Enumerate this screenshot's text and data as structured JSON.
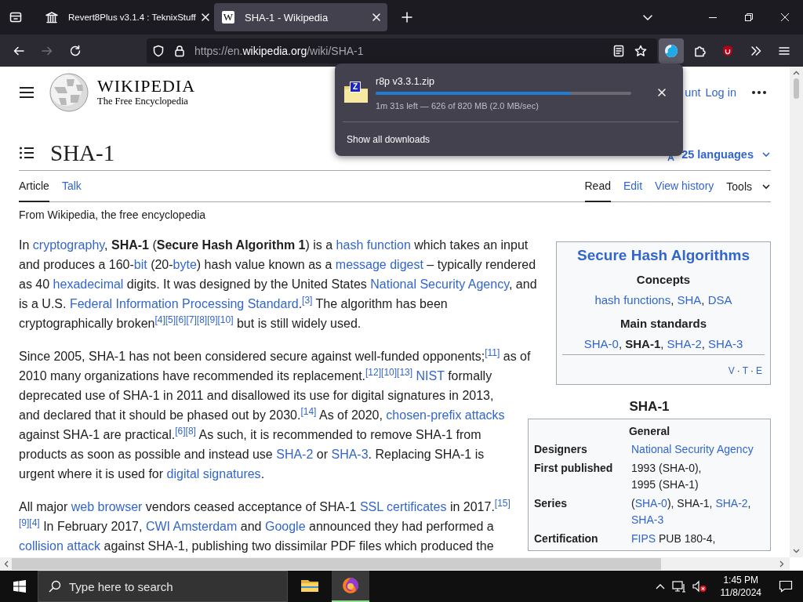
{
  "browser": {
    "tabs": [
      {
        "title": "Revert8Plus v3.1.4 : TeknixStuff",
        "icon": {
          "kind": "building"
        },
        "selected": false
      },
      {
        "title": "SHA-1 - Wikipedia",
        "icon": {
          "kind": "letter",
          "text": "W"
        },
        "selected": true
      }
    ],
    "nav_buttons": [
      {
        "kind": "back",
        "disabled": false
      },
      {
        "kind": "forward",
        "disabled": true
      },
      {
        "kind": "reload",
        "disabled": false
      }
    ],
    "address": {
      "scheme": "https://en.",
      "domain": "wikipedia.org",
      "path": "/wiki/SHA-1"
    },
    "toolbar_buttons": [
      {
        "kind": "downloads",
        "selected": true
      },
      {
        "kind": "extensions",
        "selected": false
      },
      {
        "kind": "ublock",
        "selected": false
      },
      {
        "kind": "overflow",
        "selected": false
      },
      {
        "kind": "menu",
        "selected": false
      }
    ]
  },
  "downloads_panel": {
    "items": [
      {
        "filename": "r8p v3.3.1.zip",
        "badge": "Z",
        "level": 0.76,
        "status": "1m 31s left — 626 of 820 MB (2.0 MB/sec)"
      }
    ],
    "footer": "Show all downloads"
  },
  "page": {
    "header": {
      "wordmark": "WIKIPEDIA",
      "tagline": "The Free Encyclopedia",
      "user_links": [
        "unt",
        "Log in"
      ]
    },
    "title": "SHA-1",
    "languages": "25 languages",
    "left_tabs": [
      {
        "label": "Article",
        "selected": true
      },
      {
        "label": "Talk",
        "selected": false
      }
    ],
    "right_tabs": [
      {
        "label": "Read",
        "selected": true
      },
      {
        "label": "Edit",
        "selected": false
      },
      {
        "label": "View history",
        "selected": false
      }
    ],
    "tools": "Tools",
    "tagline": "From Wikipedia, the free encyclopedia",
    "paragraphs": [
      [
        {
          "kind": "text",
          "text": "In "
        },
        {
          "kind": "link",
          "text": "cryptography"
        },
        {
          "kind": "text",
          "text": ", "
        },
        {
          "kind": "bold",
          "text": "SHA-1"
        },
        {
          "kind": "text",
          "text": " ("
        },
        {
          "kind": "bold",
          "text": "Secure Hash Algorithm 1"
        },
        {
          "kind": "text",
          "text": ") is a "
        },
        {
          "kind": "link",
          "text": "hash function"
        },
        {
          "kind": "text",
          "text": " which takes an input and produces a 160-"
        },
        {
          "kind": "link",
          "text": "bit"
        },
        {
          "kind": "text",
          "text": " (20-"
        },
        {
          "kind": "link",
          "text": "byte"
        },
        {
          "kind": "text",
          "text": ") hash value known as a "
        },
        {
          "kind": "link",
          "text": "message digest"
        },
        {
          "kind": "text",
          "text": " – typically rendered as 40 "
        },
        {
          "kind": "link",
          "text": "hexadecimal"
        },
        {
          "kind": "text",
          "text": " digits. It was designed by the United States "
        },
        {
          "kind": "link",
          "text": "National Security Agency"
        },
        {
          "kind": "text",
          "text": ", and is a U.S. "
        },
        {
          "kind": "link",
          "text": "Federal Information Processing Standard"
        },
        {
          "kind": "text",
          "text": "."
        },
        {
          "kind": "ref",
          "text": "[3]"
        },
        {
          "kind": "text",
          "text": " The algorithm has been cryptographically broken"
        },
        {
          "kind": "ref",
          "text": "[4]"
        },
        {
          "kind": "ref",
          "text": "[5]"
        },
        {
          "kind": "ref",
          "text": "[6]"
        },
        {
          "kind": "ref",
          "text": "[7]"
        },
        {
          "kind": "ref",
          "text": "[8]"
        },
        {
          "kind": "ref",
          "text": "[9]"
        },
        {
          "kind": "ref",
          "text": "[10]"
        },
        {
          "kind": "text",
          "text": " but is still widely used."
        }
      ],
      [
        {
          "kind": "text",
          "text": "Since 2005, SHA-1 has not been considered secure against well-funded opponents;"
        },
        {
          "kind": "ref",
          "text": "[11]"
        },
        {
          "kind": "text",
          "text": " as of 2010 many organizations have recommended its replacement."
        },
        {
          "kind": "ref",
          "text": "[12]"
        },
        {
          "kind": "ref",
          "text": "[10]"
        },
        {
          "kind": "ref",
          "text": "[13]"
        },
        {
          "kind": "space"
        },
        {
          "kind": "link",
          "text": "NIST"
        },
        {
          "kind": "text",
          "text": " formally deprecated use of SHA-1 in 2011 and disallowed its use for digital signatures in 2013, and declared that it should be phased out by 2030."
        },
        {
          "kind": "ref",
          "text": "[14]"
        },
        {
          "kind": "text",
          "text": " As of 2020, "
        },
        {
          "kind": "link",
          "text": "chosen-prefix attacks"
        },
        {
          "kind": "text",
          "text": " against SHA-1 are practical."
        },
        {
          "kind": "ref",
          "text": "[6]"
        },
        {
          "kind": "ref",
          "text": "[8]"
        },
        {
          "kind": "text",
          "text": " As such, it is recommended to remove SHA-1 from products as soon as possible and instead use "
        },
        {
          "kind": "link",
          "text": "SHA-2"
        },
        {
          "kind": "text",
          "text": " or "
        },
        {
          "kind": "link",
          "text": "SHA-3"
        },
        {
          "kind": "text",
          "text": ". Replacing SHA-1 is urgent where it is used for "
        },
        {
          "kind": "link",
          "text": "digital signatures"
        },
        {
          "kind": "text",
          "text": "."
        }
      ],
      [
        {
          "kind": "text",
          "text": "All major "
        },
        {
          "kind": "link",
          "text": "web browser"
        },
        {
          "kind": "text",
          "text": " vendors ceased acceptance of SHA-1 "
        },
        {
          "kind": "link",
          "text": "SSL certificates"
        },
        {
          "kind": "text",
          "text": " in 2017."
        },
        {
          "kind": "ref",
          "text": "[15]"
        },
        {
          "kind": "ref",
          "text": "[9]"
        },
        {
          "kind": "ref",
          "text": "[4]"
        },
        {
          "kind": "text",
          "text": " In February 2017, "
        },
        {
          "kind": "link",
          "text": "CWI Amsterdam"
        },
        {
          "kind": "text",
          "text": " and "
        },
        {
          "kind": "link",
          "text": "Google"
        },
        {
          "kind": "text",
          "text": " announced they had performed a "
        },
        {
          "kind": "link",
          "text": "collision attack"
        },
        {
          "kind": "text",
          "text": " against SHA-1, publishing two dissimilar PDF files which produced the"
        }
      ]
    ],
    "sidebar": {
      "title": "Secure Hash Algorithms",
      "sections": [
        {
          "heading": "Concepts",
          "items": [
            {
              "kind": "link",
              "text": "hash functions"
            },
            {
              "kind": "text",
              "text": ", "
            },
            {
              "kind": "link",
              "text": "SHA"
            },
            {
              "kind": "text",
              "text": ", "
            },
            {
              "kind": "link",
              "text": "DSA"
            }
          ]
        },
        {
          "heading": "Main standards",
          "items": [
            {
              "kind": "link",
              "text": "SHA-0"
            },
            {
              "kind": "text",
              "text": ", "
            },
            {
              "kind": "bold",
              "text": "SHA-1"
            },
            {
              "kind": "text",
              "text": ", "
            },
            {
              "kind": "link",
              "text": "SHA-2"
            },
            {
              "kind": "text",
              "text": ", "
            },
            {
              "kind": "link",
              "text": "SHA-3"
            }
          ]
        }
      ],
      "navbar": [
        {
          "kind": "link",
          "text": "V"
        },
        {
          "kind": "text",
          "text": "·"
        },
        {
          "kind": "link",
          "text": "T"
        },
        {
          "kind": "text",
          "text": "·"
        },
        {
          "kind": "link",
          "text": "E"
        }
      ]
    },
    "infobox": {
      "caption": "SHA-1",
      "section": "General",
      "rows": [
        {
          "label": "Designers",
          "lines": [
            [
              {
                "kind": "link",
                "text": "National Security Agency"
              }
            ]
          ]
        },
        {
          "label": "First published",
          "lines": [
            [
              {
                "kind": "text",
                "text": "1993 (SHA-0),"
              }
            ],
            [
              {
                "kind": "text",
                "text": "1995 (SHA-1)"
              }
            ]
          ]
        },
        {
          "label": "Series",
          "lines": [
            [
              {
                "kind": "text",
                "text": "("
              },
              {
                "kind": "link",
                "text": "SHA-0"
              },
              {
                "kind": "text",
                "text": "), SHA-1, "
              },
              {
                "kind": "link",
                "text": "SHA-2"
              },
              {
                "kind": "text",
                "text": ","
              }
            ],
            [
              {
                "kind": "link",
                "text": "SHA-3"
              }
            ]
          ]
        },
        {
          "label": "Certification",
          "lines": [
            [
              {
                "kind": "link",
                "text": "FIPS"
              },
              {
                "kind": "text",
                "text": " PUB 180-4,"
              }
            ]
          ]
        }
      ]
    }
  },
  "taskbar": {
    "search_placeholder": "Type here to search",
    "apps": [
      {
        "kind": "explorer",
        "selected": false
      },
      {
        "kind": "firefox",
        "selected": true
      }
    ],
    "volume_muted": true,
    "time": "1:45 PM",
    "date": "11/8/2024"
  }
}
